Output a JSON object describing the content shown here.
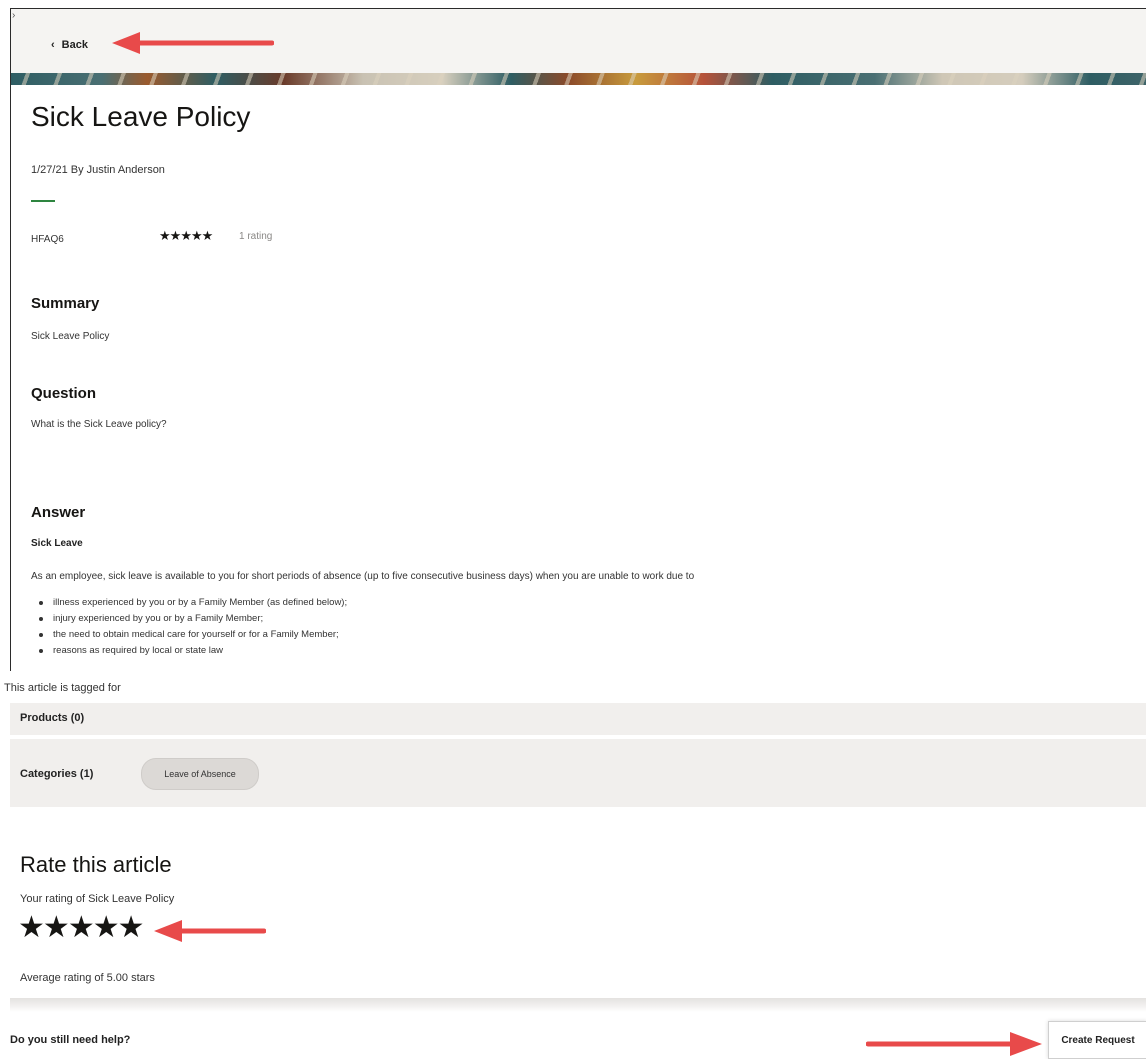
{
  "nav": {
    "back_label": "Back"
  },
  "article": {
    "title": "Sick Leave Policy",
    "meta": "1/27/21 By Justin Anderson",
    "doc_id": "HFAQ6",
    "rating_stars": 5,
    "rating_count": "1 rating",
    "summary_heading": "Summary",
    "summary_text": "Sick Leave Policy",
    "question_heading": "Question",
    "question_text": "What is the Sick Leave policy?",
    "answer_heading": "Answer",
    "answer_subheading": "Sick Leave",
    "answer_intro": "As an employee, sick leave is available to you for short periods of absence (up to five consecutive business days) when you are unable to work due to",
    "answer_items": [
      "illness experienced by you or by a Family Member (as defined below);",
      "injury experienced by you or by a Family Member;",
      "the need to obtain medical care for yourself or for a Family Member;",
      "reasons as required by local or state law"
    ]
  },
  "tags": {
    "intro": "This article is tagged for",
    "products_label": "Products (0)",
    "categories_label": "Categories (1)",
    "categories": [
      "Leave of Absence"
    ]
  },
  "rating": {
    "heading": "Rate this article",
    "your_rating_label": "Your rating of Sick Leave Policy",
    "user_stars": 5,
    "average_text": "Average rating of 5.00 stars"
  },
  "help": {
    "prompt": "Do you still need help?",
    "create_request_label": "Create Request"
  },
  "colors": {
    "accent_green": "#2e8540",
    "annotation_arrow": "#e84a4a",
    "chip_bg": "#dcd9d6"
  }
}
